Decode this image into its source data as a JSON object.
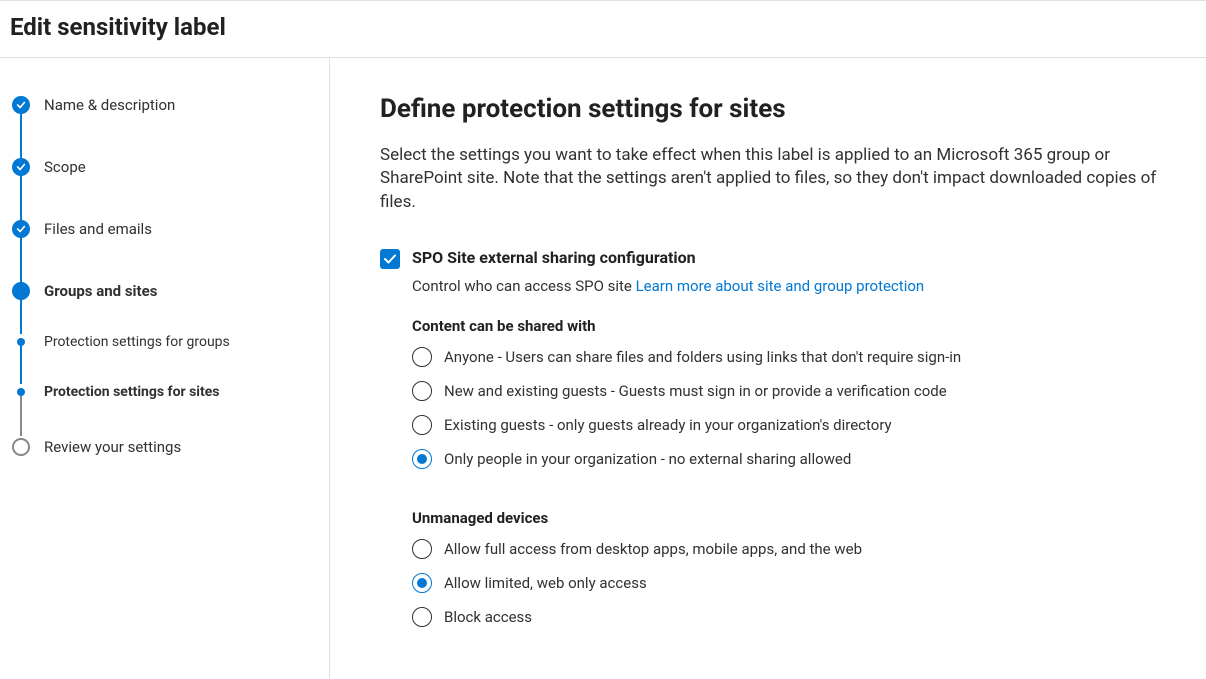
{
  "header": {
    "title": "Edit sensitivity label"
  },
  "nav": {
    "items": [
      {
        "label": "Name & description",
        "state": "completed"
      },
      {
        "label": "Scope",
        "state": "completed"
      },
      {
        "label": "Files and emails",
        "state": "completed"
      },
      {
        "label": "Groups and sites",
        "state": "current"
      },
      {
        "label": "Protection settings for groups",
        "state": "sub"
      },
      {
        "label": "Protection settings for sites",
        "state": "sub-current"
      },
      {
        "label": "Review your settings",
        "state": "future"
      }
    ]
  },
  "main": {
    "heading": "Define protection settings for sites",
    "description": "Select the settings you want to take effect when this label is applied to an Microsoft 365 group or SharePoint site. Note that the settings aren't applied to files, so they don't impact downloaded copies of files.",
    "checkbox_label": "SPO Site external sharing configuration",
    "checkbox_sub_text": "Control who can access SPO site ",
    "checkbox_sub_link": "Learn more about site and group protection",
    "sharing_section_label": "Content can be shared with",
    "sharing_options": [
      "Anyone - Users can share files and folders using links that don't require sign-in",
      "New and existing guests - Guests must sign in or provide a verification code",
      "Existing guests - only guests already in your organization's directory",
      "Only people in your organization - no external sharing allowed"
    ],
    "sharing_selected_index": 3,
    "devices_section_label": "Unmanaged devices",
    "devices_options": [
      "Allow full access from desktop apps, mobile apps, and the web",
      "Allow limited, web only access",
      "Block access"
    ],
    "devices_selected_index": 1
  }
}
